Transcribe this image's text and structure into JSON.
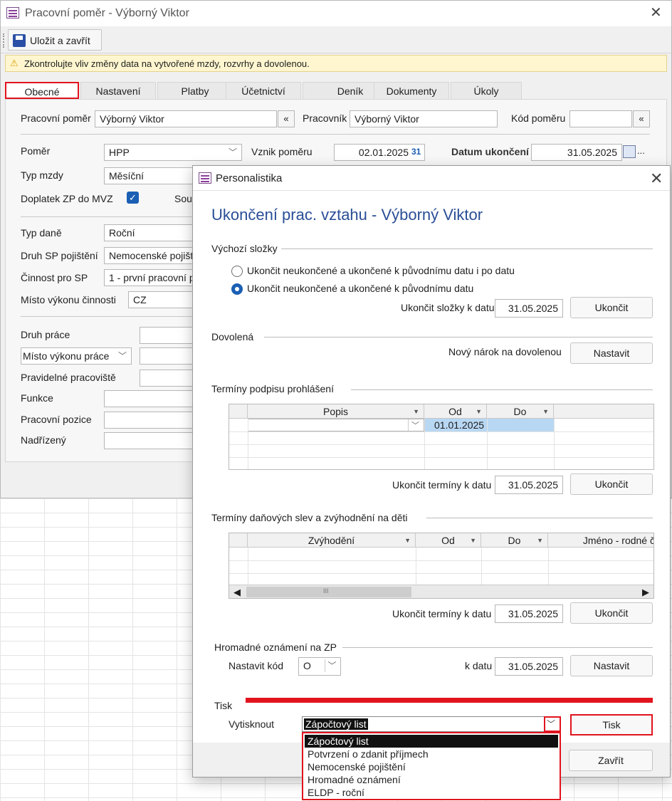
{
  "main_window": {
    "title": "Pracovní poměr - Výborný Viktor",
    "save_button": "Uložit a zavřít",
    "warning": "Zkontrolujte vliv změny data na vytvořené mzdy, rozvrhy a dovolenou.",
    "tabs": [
      "Obecné",
      "Nastavení",
      "Platby",
      "Účetnictví",
      "Deník",
      "Dokumenty",
      "Úkoly"
    ],
    "active_tab": "Obecné",
    "fields": {
      "pracovni_pomer_label": "Pracovní poměr",
      "pracovni_pomer_value": "Výborný Viktor",
      "pracovnik_label": "Pracovník",
      "pracovnik_value": "Výborný Viktor",
      "kod_pomeru_label": "Kód poměru",
      "kod_pomeru_value": "",
      "pomer_label": "Poměr",
      "pomer_value": "HPP",
      "vznik_pomeru_label": "Vznik poměru",
      "vznik_pomeru_value": "02.01.2025",
      "datum_ukonceni_label": "Datum ukončení",
      "datum_ukonceni_value": "31.05.2025",
      "typ_mzdy_label": "Typ mzdy",
      "typ_mzdy_value": "Měsíční",
      "doplatek_label": "Doplatek ZP do MVZ",
      "doplatek_checked": true,
      "sou_label": "Sou",
      "typ_dane_label": "Typ daně",
      "typ_dane_value": "Roční",
      "druh_sp_label": "Druh SP pojištění",
      "druh_sp_value": "Nemocenské pojiště",
      "cinnost_label": "Činnost pro SP",
      "cinnost_value": "1 - první pracovní p",
      "misto_cinnosti_label": "Místo výkonu činnosti",
      "misto_cinnosti_value": "CZ",
      "druh_prace_label": "Druh práce",
      "misto_prace_label": "Místo výkonu práce",
      "pravidelne_label": "Pravidelné pracoviště",
      "funkce_label": "Funkce",
      "pracovni_pozice_label": "Pracovní pozice",
      "nadrizeny_label": "Nadřízený"
    },
    "mini_button": "«"
  },
  "dialog": {
    "window_title": "Personalistika",
    "heading": "Ukončení prac. vztahu - Výborný Viktor",
    "vychozi": {
      "title": "Výchozí složky",
      "option1": "Ukončit neukončené a ukončené k původnímu datu i po datu",
      "option2": "Ukončit neukončené a ukončené k původnímu datu",
      "selected": 2,
      "date_label": "Ukončit složky k datu",
      "date_value": "31.05.2025",
      "button": "Ukončit"
    },
    "dovolena": {
      "title": "Dovolená",
      "label": "Nový nárok na dovolenou",
      "button": "Nastavit"
    },
    "terminy_podpisu": {
      "title": "Termíny podpisu prohlášení",
      "columns": [
        "Popis",
        "Od",
        "Do"
      ],
      "rows": [
        [
          "",
          "01.01.2025",
          ""
        ]
      ],
      "date_label": "Ukončit termíny k datu",
      "date_value": "31.05.2025",
      "button": "Ukončit"
    },
    "terminy_slev": {
      "title": "Termíny daňových slev a zvýhodnění na děti",
      "columns": [
        "Zvýhodění",
        "Od",
        "Do",
        "Jméno - rodné č"
      ],
      "scroll_grip": "III",
      "date_label": "Ukončit termíny k datu",
      "date_value": "31.05.2025",
      "button": "Ukončit"
    },
    "hromadne": {
      "title": "Hromadné oznámení na ZP",
      "kod_label": "Nastavit kód",
      "kod_value": "O",
      "date_label": "k datu",
      "date_value": "31.05.2025",
      "button": "Nastavit"
    },
    "tisk": {
      "title": "Tisk",
      "label": "Vytisknout",
      "selected": "Zápočtový list",
      "options": [
        "Zápočtový list",
        "Potvrzení o zdanit příjmech",
        "Nemocenské pojištění",
        "Hromadné oznámení",
        "ELDP - roční"
      ],
      "button": "Tisk"
    },
    "close_button": "Zavřít"
  },
  "colors": {
    "accent_red": "#e1141e",
    "heading_blue": "#2a4e96",
    "checkbox_blue": "#1a5fb4",
    "warning_bg": "#fff6cf",
    "grid_selected": "#cde3f7"
  }
}
